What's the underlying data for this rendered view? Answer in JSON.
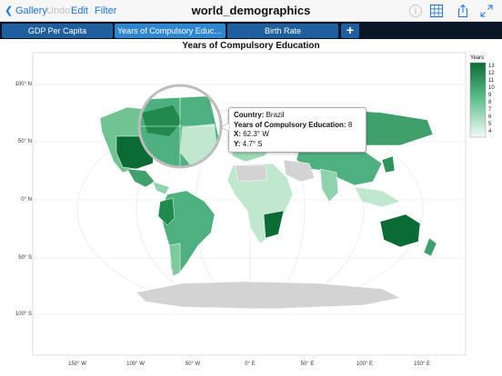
{
  "toolbar": {
    "back_label": "Gallery",
    "undo_label": "Undo",
    "edit_label": "Edit",
    "filter_label": "Filter",
    "title": "world_demographics"
  },
  "tabs": [
    {
      "label": "GDP Per Capita",
      "active": false
    },
    {
      "label": "Years of Compulsory Educa...",
      "active": true
    },
    {
      "label": "Birth Rate",
      "active": false
    }
  ],
  "add_tab_label": "+",
  "chart_data": {
    "type": "choropleth map",
    "title": "Years of Compulsory Education",
    "legend_title": "Years",
    "legend_values": [
      "13",
      "12",
      "11",
      "10",
      "9",
      "8",
      "7",
      "6",
      "5",
      "4"
    ],
    "y_ticks": [
      "100° N",
      "50° N",
      "0° N",
      "50° S",
      "100° S"
    ],
    "x_ticks": [
      "150° W",
      "100° W",
      "50° W",
      "0° E",
      "50° E",
      "100° E",
      "150° E"
    ],
    "colors": {
      "low": "#f2fbf6",
      "high": "#0b6b35",
      "no_data": "#d3d3d3"
    }
  },
  "tooltip": {
    "country_key": "Country:",
    "country_value": "Brazil",
    "years_key": "Years of Compulsory Education:",
    "years_value": "8",
    "x_key": "X:",
    "x_value": "62.3° W",
    "y_key": "Y:",
    "y_value": "4.7° S"
  }
}
